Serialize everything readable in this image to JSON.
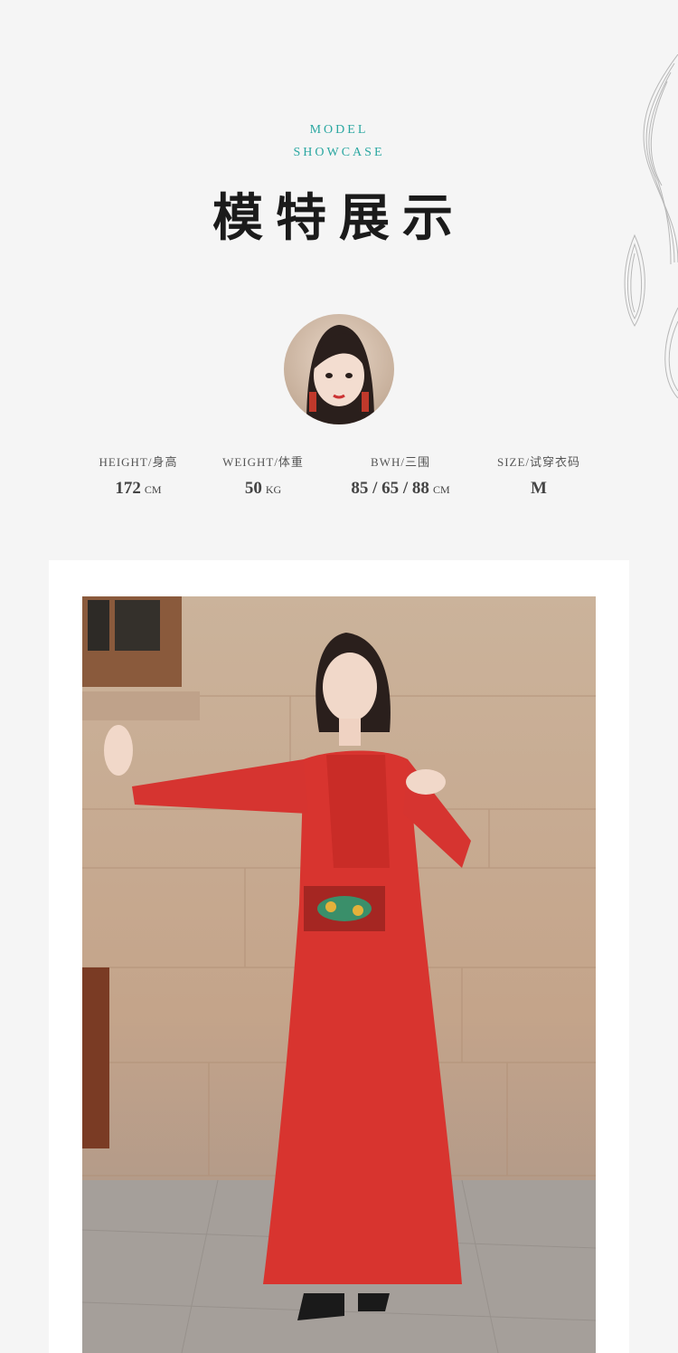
{
  "header": {
    "eyebrow_line1": "MODEL",
    "eyebrow_line2": "SHOWCASE",
    "title": "模特展示"
  },
  "stats": [
    {
      "label": "HEIGHT/身高",
      "value": "172",
      "unit": "CM"
    },
    {
      "label": "WEIGHT/体重",
      "value": "50",
      "unit": "KG"
    },
    {
      "label": "BWH/三围",
      "value": "85 / 65 / 88",
      "unit": "CM"
    },
    {
      "label": "SIZE/试穿衣码",
      "value": "M",
      "unit": ""
    }
  ],
  "colors": {
    "accent": "#2aa7a1",
    "dress": "#d8342f",
    "background": "#f5f5f5"
  }
}
